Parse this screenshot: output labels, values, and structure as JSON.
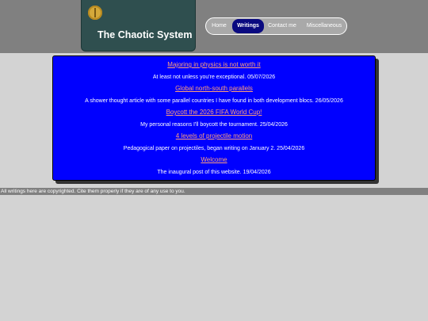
{
  "site": {
    "title": "The Chaotic System"
  },
  "nav": {
    "items": [
      {
        "label": "Home"
      },
      {
        "label": "Writings",
        "active": true
      },
      {
        "label": "Contact me"
      },
      {
        "label": "Miscellaneous"
      }
    ]
  },
  "posts": [
    {
      "title": "Majoring in physics is not worth it",
      "description": "At least not unless you're exceptional. 05/07/2026"
    },
    {
      "title": "Global north-south parallels",
      "description": "A shower thought article with some parallel countries I have found in both development blocs. 26/05/2026"
    },
    {
      "title": "Boycott the 2026 FIFA World Cup!",
      "description": "My personal reasons I'll boycott the tournament. 25/04/2026"
    },
    {
      "title": "4 levels of projectile motion",
      "description": "Pedagogical paper on projectiles, began writing on January 2. 25/04/2026"
    },
    {
      "title": "Welcome",
      "description": "The inaugural post of this website. 19/04/2026"
    }
  ],
  "footer": {
    "text": "All writings here are copyrighted. Cite them properly if they are of any use to you."
  },
  "colors": {
    "header_bg": "#808080",
    "logo_bg": "#2f4f4f",
    "panel_bg": "#0000ff",
    "link": "#ffa07a",
    "nav_active": "#0a0a80",
    "page_bg": "#d3d3d3"
  }
}
